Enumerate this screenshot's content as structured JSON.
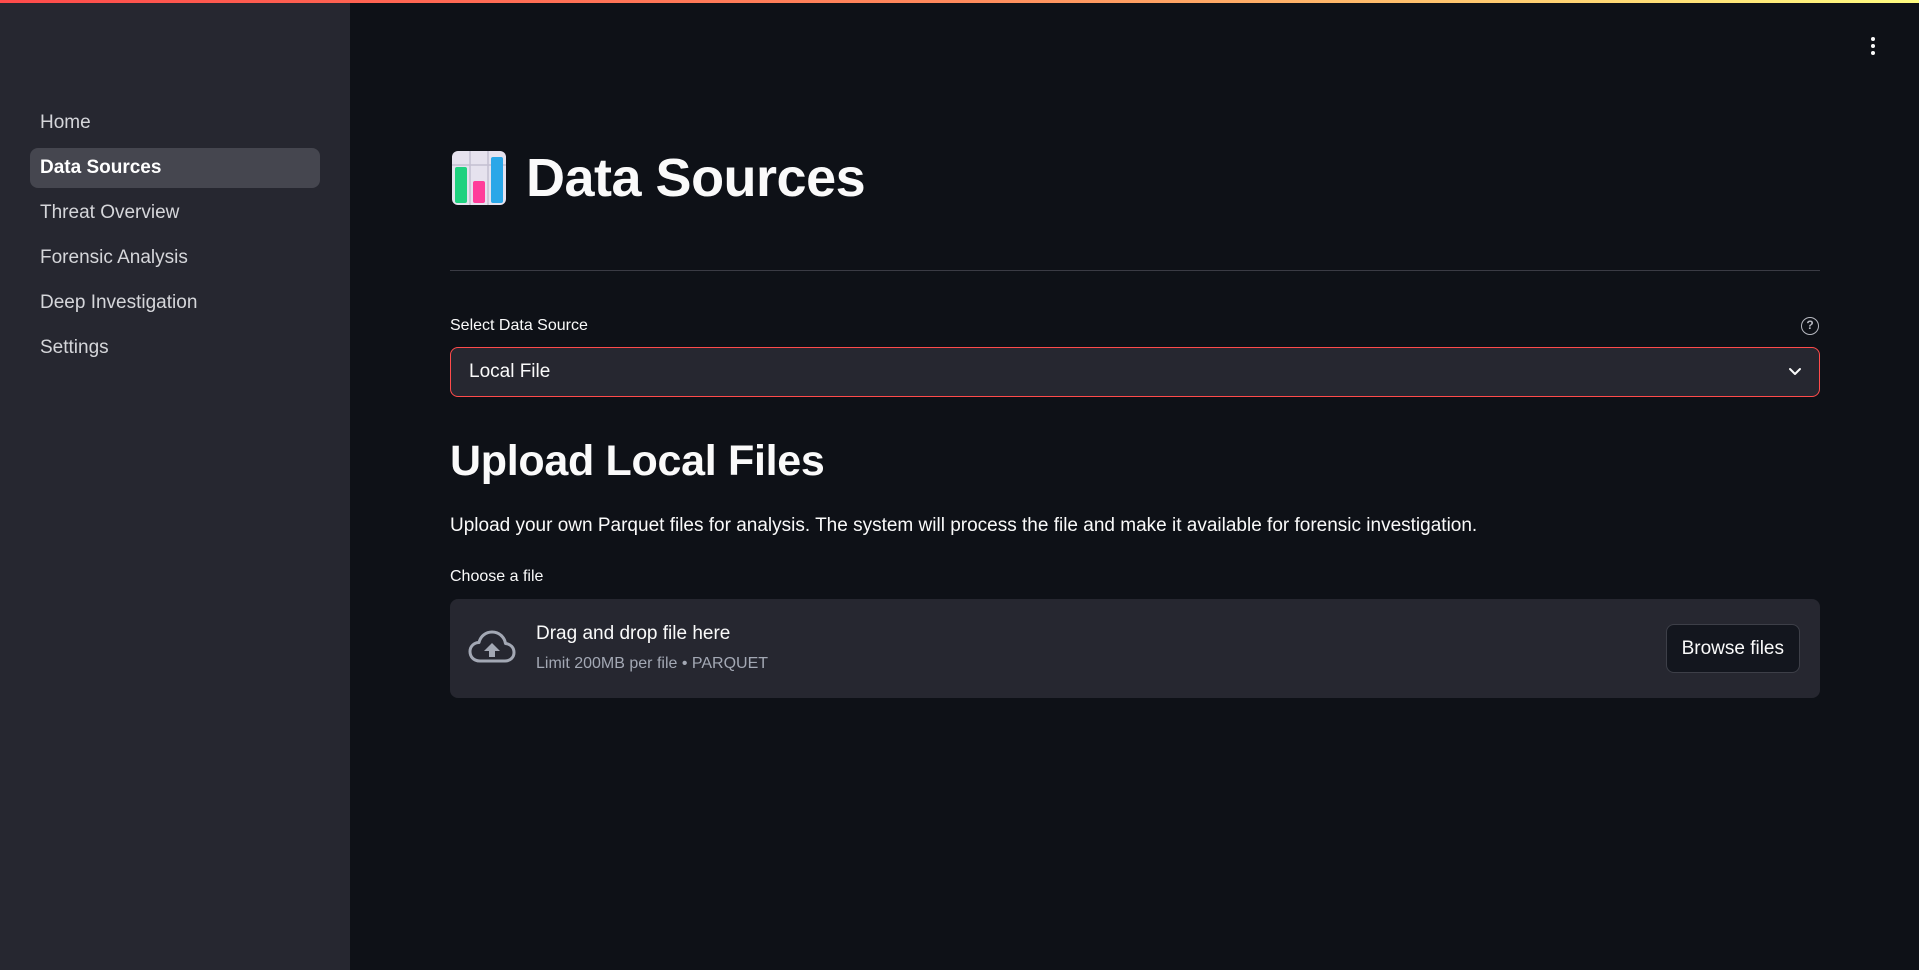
{
  "sidebar": {
    "items": [
      {
        "label": "Home",
        "active": false
      },
      {
        "label": "Data Sources",
        "active": true
      },
      {
        "label": "Threat Overview",
        "active": false
      },
      {
        "label": "Forensic Analysis",
        "active": false
      },
      {
        "label": "Deep Investigation",
        "active": false
      },
      {
        "label": "Settings",
        "active": false
      }
    ]
  },
  "header": {
    "emoji_icon": "bar-chart-icon",
    "title": "Data Sources",
    "menu_icon": "more-vertical-icon"
  },
  "select": {
    "label": "Select Data Source",
    "help_icon": "question-circle-icon",
    "value": "Local File",
    "chevron_icon": "chevron-down-icon"
  },
  "upload": {
    "title": "Upload Local Files",
    "description": "Upload your own Parquet files for analysis. The system will process the file and make it available for forensic investigation.",
    "field_label": "Choose a file",
    "drop_icon": "cloud-upload-icon",
    "drop_title": "Drag and drop file here",
    "drop_limit": "Limit 200MB per file • PARQUET",
    "browse_label": "Browse files"
  },
  "colors": {
    "accent": "#ff4b4b",
    "background": "#0e1117",
    "sidebar": "#262730"
  }
}
